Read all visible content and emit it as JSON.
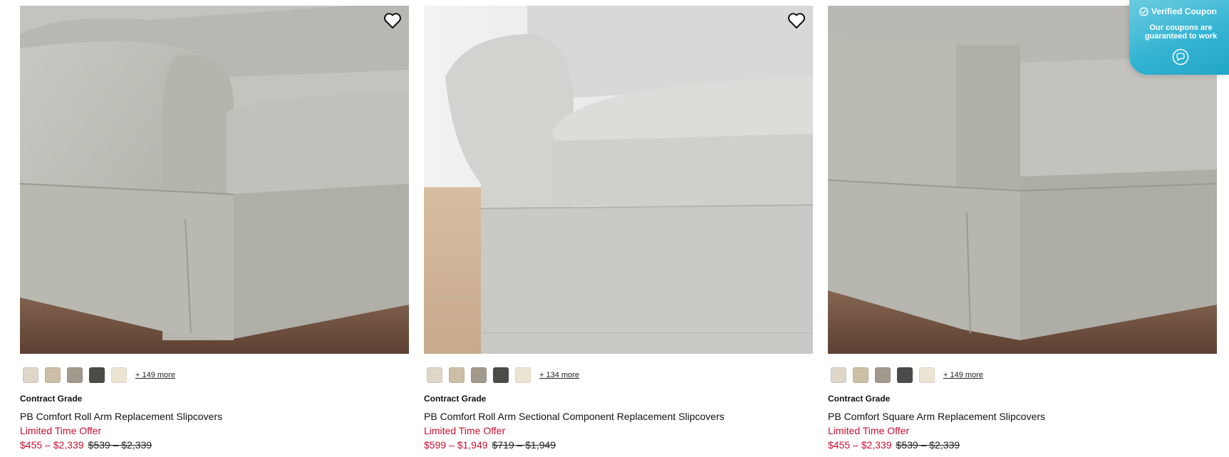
{
  "products": [
    {
      "grade": "Contract Grade",
      "name": "PB Comfort Roll Arm Replacement Slipcovers",
      "offer": "Limited Time Offer",
      "price": "$455 – $2,339",
      "original_price": "$539 – $2,339",
      "more_colors": "+ 149 more",
      "swatch_colors": [
        "#ddd6c9",
        "#cdbfa6",
        "#a39a8e",
        "#4b4c48",
        "#ece5d3"
      ],
      "photo_icon": "roll-arm-sofa-photo",
      "favorite_icon": "heart-outline-icon"
    },
    {
      "grade": "Contract Grade",
      "name": "PB Comfort Roll Arm Sectional Component Replacement Slipcovers",
      "offer": "Limited Time Offer",
      "price": "$599 – $1,949",
      "original_price": "$719 – $1,949",
      "more_colors": "+ 134 more",
      "swatch_colors": [
        "#ddd6c9",
        "#cdbfa6",
        "#a39a8e",
        "#4b4c48",
        "#ece5d3"
      ],
      "photo_icon": "roll-arm-sectional-photo",
      "favorite_icon": "heart-outline-icon"
    },
    {
      "grade": "Contract Grade",
      "name": "PB Comfort Square Arm Replacement Slipcovers",
      "offer": "Limited Time Offer",
      "price": "$455 – $2,339",
      "original_price": "$539 – $2,339",
      "more_colors": "+ 149 more",
      "swatch_colors": [
        "#ddd6c9",
        "#cdbfa6",
        "#a39a8e",
        "#4b4c48",
        "#ece5d3"
      ],
      "photo_icon": "square-arm-sofa-photo",
      "favorite_icon": "heart-outline-icon"
    }
  ],
  "coupon": {
    "title": "Verified Coupon",
    "subtitle": "Our coupons are guaranteed to work",
    "check_icon": "check-circle-icon",
    "chat_icon": "chat-bubble-icon",
    "accent": "#35b4d3"
  },
  "colors": {
    "sale_red": "#c8102e",
    "text": "#111111"
  }
}
